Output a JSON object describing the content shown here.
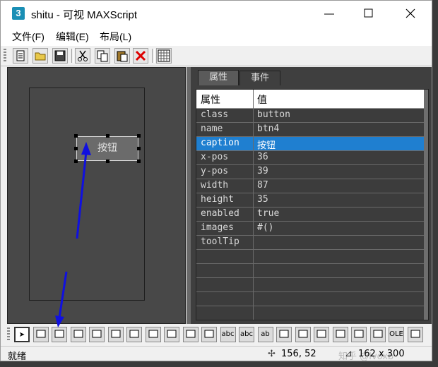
{
  "window": {
    "icon": "3",
    "title": "shitu - 可视 MAXScript"
  },
  "menu": [
    "文件(F)",
    "编辑(E)",
    "布局(L)"
  ],
  "toolbar": [
    "new-file-icon",
    "open-folder-icon",
    "save-icon",
    "cut-icon",
    "copy-icon",
    "paste-icon",
    "delete-icon",
    "grid-icon"
  ],
  "designer": {
    "button_caption": "按钮"
  },
  "properties": {
    "tabs": [
      "属性",
      "事件"
    ],
    "active_tab": "属性",
    "header": {
      "name": "属性",
      "value": "值"
    },
    "rows": [
      {
        "name": "class",
        "value": "button"
      },
      {
        "name": "name",
        "value": "btn4"
      },
      {
        "name": "caption",
        "value": "按钮"
      },
      {
        "name": "x-pos",
        "value": "36"
      },
      {
        "name": "y-pos",
        "value": "39"
      },
      {
        "name": "width",
        "value": "87"
      },
      {
        "name": "height",
        "value": "35"
      },
      {
        "name": "enabled",
        "value": "true"
      },
      {
        "name": "images",
        "value": "#()"
      },
      {
        "name": "toolTip",
        "value": ""
      }
    ],
    "selected_row": "caption"
  },
  "controls_bar": [
    {
      "icon": "pointer-icon",
      "text": ""
    },
    {
      "icon": "bitmap-icon",
      "text": ""
    },
    {
      "icon": "button-icon",
      "text": ""
    },
    {
      "icon": "mapbutton-icon",
      "text": ""
    },
    {
      "icon": "materialbutton-icon",
      "text": ""
    },
    {
      "icon": "pickbutton-icon",
      "text": ""
    },
    {
      "icon": "checkbutton-icon",
      "text": ""
    },
    {
      "icon": "colorpicker-icon",
      "text": ""
    },
    {
      "icon": "combobox-icon",
      "text": ""
    },
    {
      "icon": "dropdownlist-icon",
      "text": ""
    },
    {
      "icon": "listbox-icon",
      "text": ""
    },
    {
      "icon": "edittext-icon",
      "text": "abc"
    },
    {
      "icon": "label-icon",
      "text": "abc"
    },
    {
      "icon": "groupbox-icon",
      "text": "ab"
    },
    {
      "icon": "checkbox-icon",
      "text": ""
    },
    {
      "icon": "radiobuttons-icon",
      "text": ""
    },
    {
      "icon": "spinner-icon",
      "text": ""
    },
    {
      "icon": "progressbar-icon",
      "text": ""
    },
    {
      "icon": "slider-icon",
      "text": ""
    },
    {
      "icon": "timer-icon",
      "text": ""
    },
    {
      "icon": "activex-icon",
      "text": "OLE"
    },
    {
      "icon": "custom-control-icon",
      "text": ""
    }
  ],
  "status": {
    "text": "就绪",
    "cursor": "156, 52",
    "size": "162 x 300",
    "watermark": "知乎 @Ivoxb"
  },
  "colors": {
    "selection": "#1f7fd0",
    "designer_bg": "#484848",
    "annotation_arrow": "#1010e0"
  }
}
